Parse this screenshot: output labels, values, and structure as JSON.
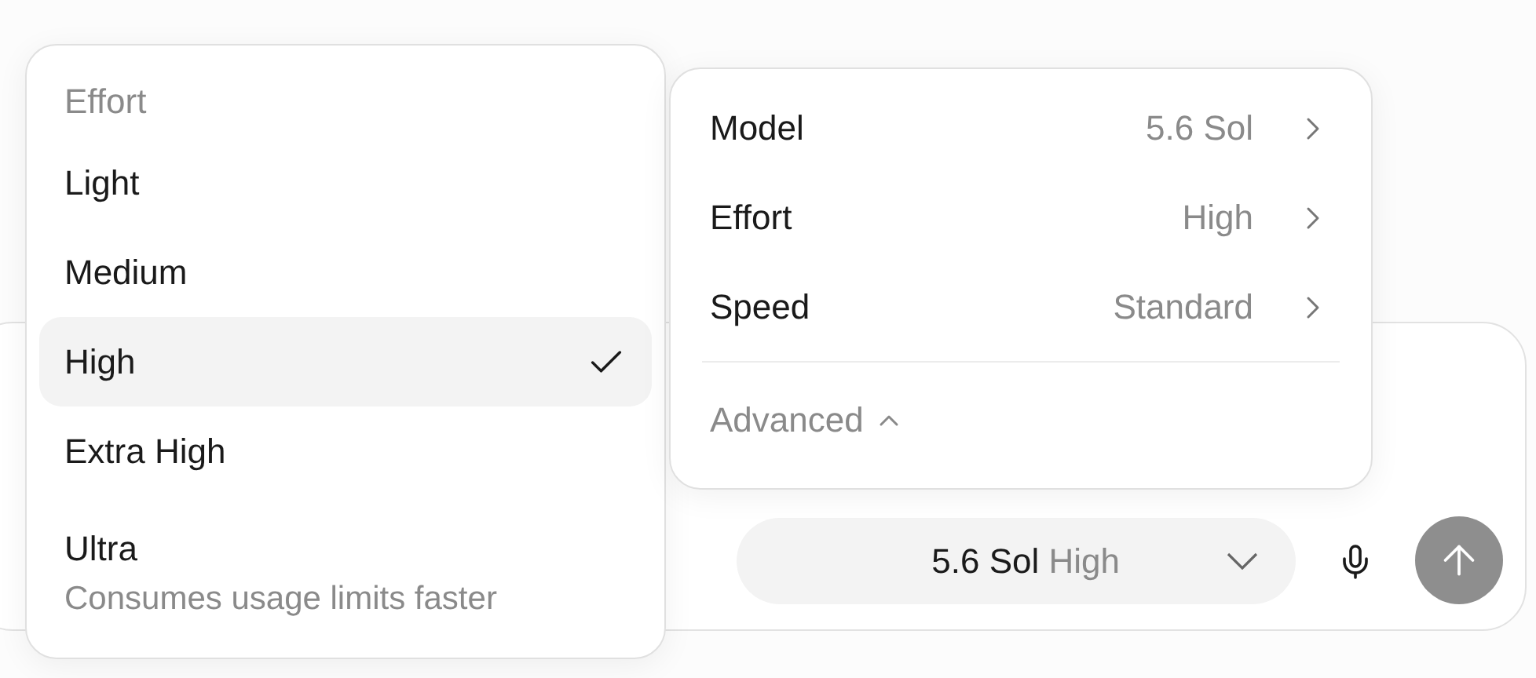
{
  "effort_menu": {
    "title": "Effort",
    "options": [
      {
        "label": "Light",
        "selected": false
      },
      {
        "label": "Medium",
        "selected": false
      },
      {
        "label": "High",
        "selected": true
      },
      {
        "label": "Extra High",
        "selected": false
      },
      {
        "label": "Ultra",
        "selected": false,
        "note": "Consumes usage limits faster"
      }
    ]
  },
  "settings_menu": {
    "rows": [
      {
        "label": "Model",
        "value": "5.6 Sol"
      },
      {
        "label": "Effort",
        "value": "High"
      },
      {
        "label": "Speed",
        "value": "Standard"
      }
    ],
    "advanced": {
      "label": "Advanced",
      "expanded": true
    }
  },
  "composer": {
    "model_picker": {
      "model": "5.6 Sol",
      "effort": "High"
    }
  }
}
